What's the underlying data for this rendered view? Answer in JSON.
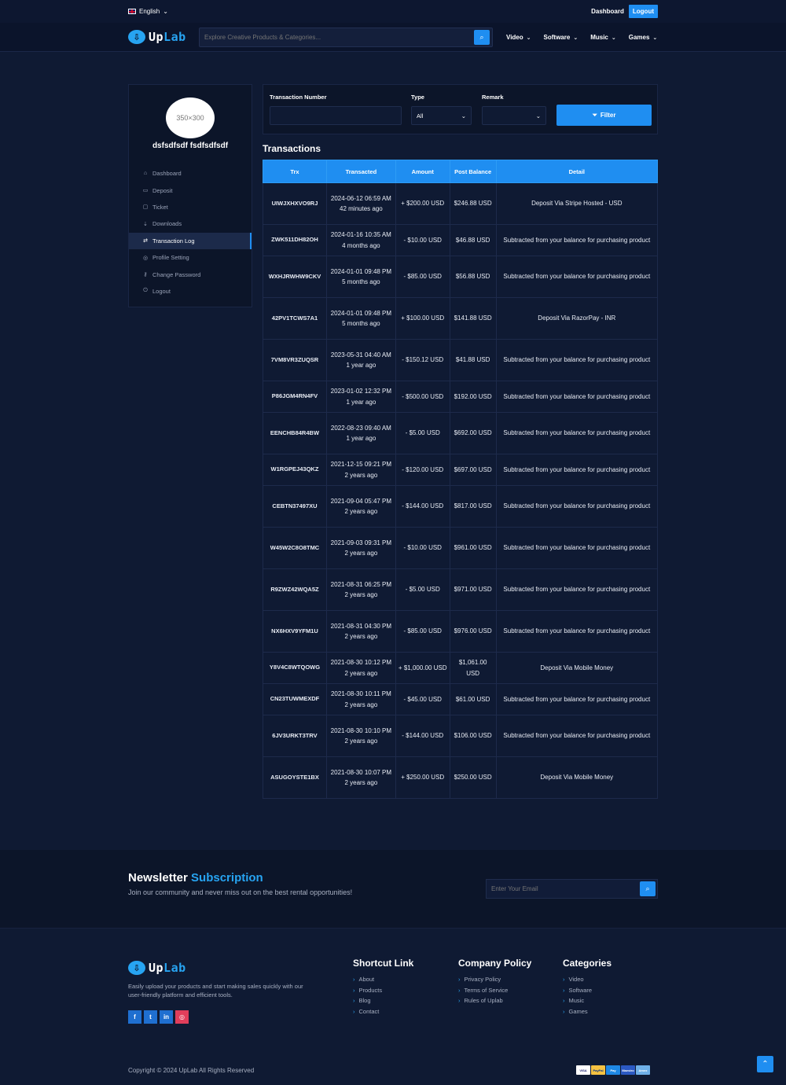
{
  "topbar": {
    "language": "English",
    "dashboard": "Dashboard",
    "logout": "Logout"
  },
  "navbar": {
    "logo_up": "Up",
    "logo_lab": "Lab",
    "search_placeholder": "Explore Creative Products & Categories...",
    "menu": [
      "Video",
      "Software",
      "Music",
      "Games"
    ]
  },
  "sidebar": {
    "avatar_text": "350×300",
    "username": "dsfsdfsdf fsdfsdfsdf",
    "items": [
      {
        "label": "Dashboard",
        "icon": "home-icon",
        "glyph": "⌂"
      },
      {
        "label": "Deposit",
        "icon": "wallet-icon",
        "glyph": "▭"
      },
      {
        "label": "Ticket",
        "icon": "ticket-icon",
        "glyph": "▢"
      },
      {
        "label": "Downloads",
        "icon": "download-icon",
        "glyph": "⇣"
      },
      {
        "label": "Transaction Log",
        "icon": "exchange-icon",
        "glyph": "⇄"
      },
      {
        "label": "Profile Setting",
        "icon": "user-icon",
        "glyph": "◎"
      },
      {
        "label": "Change Password",
        "icon": "key-icon",
        "glyph": "⚷"
      },
      {
        "label": "Logout",
        "icon": "power-icon",
        "glyph": "⏻"
      }
    ]
  },
  "filter": {
    "trx_label": "Transaction Number",
    "type_label": "Type",
    "type_value": "All",
    "remark_label": "Remark",
    "button": "Filter"
  },
  "transactions": {
    "title": "Transactions",
    "headers": [
      "Trx",
      "Transacted",
      "Amount",
      "Post Balance",
      "Detail"
    ],
    "rows": [
      {
        "trx": "UIWJXHXVO9RJ",
        "date": "2024-06-12 06:59 AM",
        "ago": "42 minutes ago",
        "amount": "+ $200.00 USD",
        "sign": "plus",
        "balance": "$246.88 USD",
        "detail": "Deposit Via Stripe Hosted - USD"
      },
      {
        "trx": "ZWK511DH82OH",
        "date": "2024-01-16 10:35 AM",
        "ago": "4 months ago",
        "amount": "- $10.00 USD",
        "sign": "minus",
        "balance": "$46.88 USD",
        "detail": "Subtracted from your balance for purchasing product"
      },
      {
        "trx": "WXHJRWHW9CKV",
        "date": "2024-01-01 09:48 PM",
        "ago": "5 months ago",
        "amount": "- $85.00 USD",
        "sign": "minus",
        "balance": "$56.88 USD",
        "detail": "Subtracted from your balance for purchasing product"
      },
      {
        "trx": "42PV1TCWS7A1",
        "date": "2024-01-01 09:48 PM",
        "ago": "5 months ago",
        "amount": "+ $100.00 USD",
        "sign": "plus",
        "balance": "$141.88 USD",
        "detail": "Deposit Via RazorPay - INR"
      },
      {
        "trx": "7VM8VR3ZUQSR",
        "date": "2023-05-31 04:40 AM",
        "ago": "1 year ago",
        "amount": "- $150.12 USD",
        "sign": "minus",
        "balance": "$41.88 USD",
        "detail": "Subtracted from your balance for purchasing product"
      },
      {
        "trx": "P86JGM4RN4FV",
        "date": "2023-01-02 12:32 PM",
        "ago": "1 year ago",
        "amount": "- $500.00 USD",
        "sign": "minus",
        "balance": "$192.00 USD",
        "detail": "Subtracted from your balance for purchasing product"
      },
      {
        "trx": "EENCHB84R4BW",
        "date": "2022-08-23 09:40 AM",
        "ago": "1 year ago",
        "amount": "- $5.00 USD",
        "sign": "minus",
        "balance": "$692.00 USD",
        "detail": "Subtracted from your balance for purchasing product"
      },
      {
        "trx": "W1RGPEJ43QKZ",
        "date": "2021-12-15 09:21 PM",
        "ago": "2 years ago",
        "amount": "- $120.00 USD",
        "sign": "minus",
        "balance": "$697.00 USD",
        "detail": "Subtracted from your balance for purchasing product"
      },
      {
        "trx": "CEBTN37497XU",
        "date": "2021-09-04 05:47 PM",
        "ago": "2 years ago",
        "amount": "- $144.00 USD",
        "sign": "minus",
        "balance": "$817.00 USD",
        "detail": "Subtracted from your balance for purchasing product"
      },
      {
        "trx": "W45W2C8O8TMC",
        "date": "2021-09-03 09:31 PM",
        "ago": "2 years ago",
        "amount": "- $10.00 USD",
        "sign": "minus",
        "balance": "$961.00 USD",
        "detail": "Subtracted from your balance for purchasing product"
      },
      {
        "trx": "R9ZWZ42WQA5Z",
        "date": "2021-08-31 06:25 PM",
        "ago": "2 years ago",
        "amount": "- $5.00 USD",
        "sign": "minus",
        "balance": "$971.00 USD",
        "detail": "Subtracted from your balance for purchasing product"
      },
      {
        "trx": "NX6HXV9YFM1U",
        "date": "2021-08-31 04:30 PM",
        "ago": "2 years ago",
        "amount": "- $85.00 USD",
        "sign": "minus",
        "balance": "$976.00 USD",
        "detail": "Subtracted from your balance for purchasing product"
      },
      {
        "trx": "Y8V4C8WTQOWG",
        "date": "2021-08-30 10:12 PM",
        "ago": "2 years ago",
        "amount": "+ $1,000.00 USD",
        "sign": "plus",
        "balance": "$1,061.00 USD",
        "detail": "Deposit Via Mobile Money"
      },
      {
        "trx": "CN23TUWMEXDF",
        "date": "2021-08-30 10:11 PM",
        "ago": "2 years ago",
        "amount": "- $45.00 USD",
        "sign": "minus",
        "balance": "$61.00 USD",
        "detail": "Subtracted from your balance for purchasing product"
      },
      {
        "trx": "6JV3URKT3TRV",
        "date": "2021-08-30 10:10 PM",
        "ago": "2 years ago",
        "amount": "- $144.00 USD",
        "sign": "minus",
        "balance": "$106.00 USD",
        "detail": "Subtracted from your balance for purchasing product"
      },
      {
        "trx": "ASUGOYSTE1BX",
        "date": "2021-08-30 10:07 PM",
        "ago": "2 years ago",
        "amount": "+ $250.00 USD",
        "sign": "plus",
        "balance": "$250.00 USD",
        "detail": "Deposit Via Mobile Money"
      }
    ]
  },
  "newsletter": {
    "title": "Newsletter",
    "title_accent": "Subscription",
    "description": "Join our community and never miss out on the best rental opportunities!",
    "placeholder": "Enter Your Email"
  },
  "footer": {
    "description": "Easily upload your products and start making sales quickly with our user-friendly platform and efficient tools.",
    "socials": [
      {
        "label": "f",
        "icon": "facebook-icon"
      },
      {
        "label": "t",
        "icon": "twitter-icon"
      },
      {
        "label": "in",
        "icon": "linkedin-icon"
      },
      {
        "label": "◎",
        "icon": "instagram-icon"
      }
    ],
    "columns": [
      {
        "title": "Shortcut Link",
        "links": [
          "About",
          "Products",
          "Blog",
          "Contact"
        ]
      },
      {
        "title": "Company Policy",
        "links": [
          "Privacy Policy",
          "Terms of Service",
          "Rules of Uplab"
        ]
      },
      {
        "title": "Categories",
        "links": [
          "Video",
          "Software",
          "Music",
          "Games"
        ]
      }
    ],
    "copyright": "Copyright © 2024 UpLab All Rights Reserved",
    "payments": [
      {
        "label": "VISA",
        "bg": "#ffffff",
        "fg": "#1a1f71"
      },
      {
        "label": "PayPal",
        "bg": "#f5c242",
        "fg": "#003087"
      },
      {
        "label": "Pay",
        "bg": "#1e88e5",
        "fg": "#ffffff"
      },
      {
        "label": "Maestro",
        "bg": "#2b59c3",
        "fg": "#ffffff"
      },
      {
        "label": "Amex",
        "bg": "#6fb0e8",
        "fg": "#ffffff"
      }
    ]
  },
  "colors": {
    "accent": "#1f8ef1",
    "plus": "#2ed573",
    "minus": "#ff4757",
    "background": "#0f1a33"
  }
}
